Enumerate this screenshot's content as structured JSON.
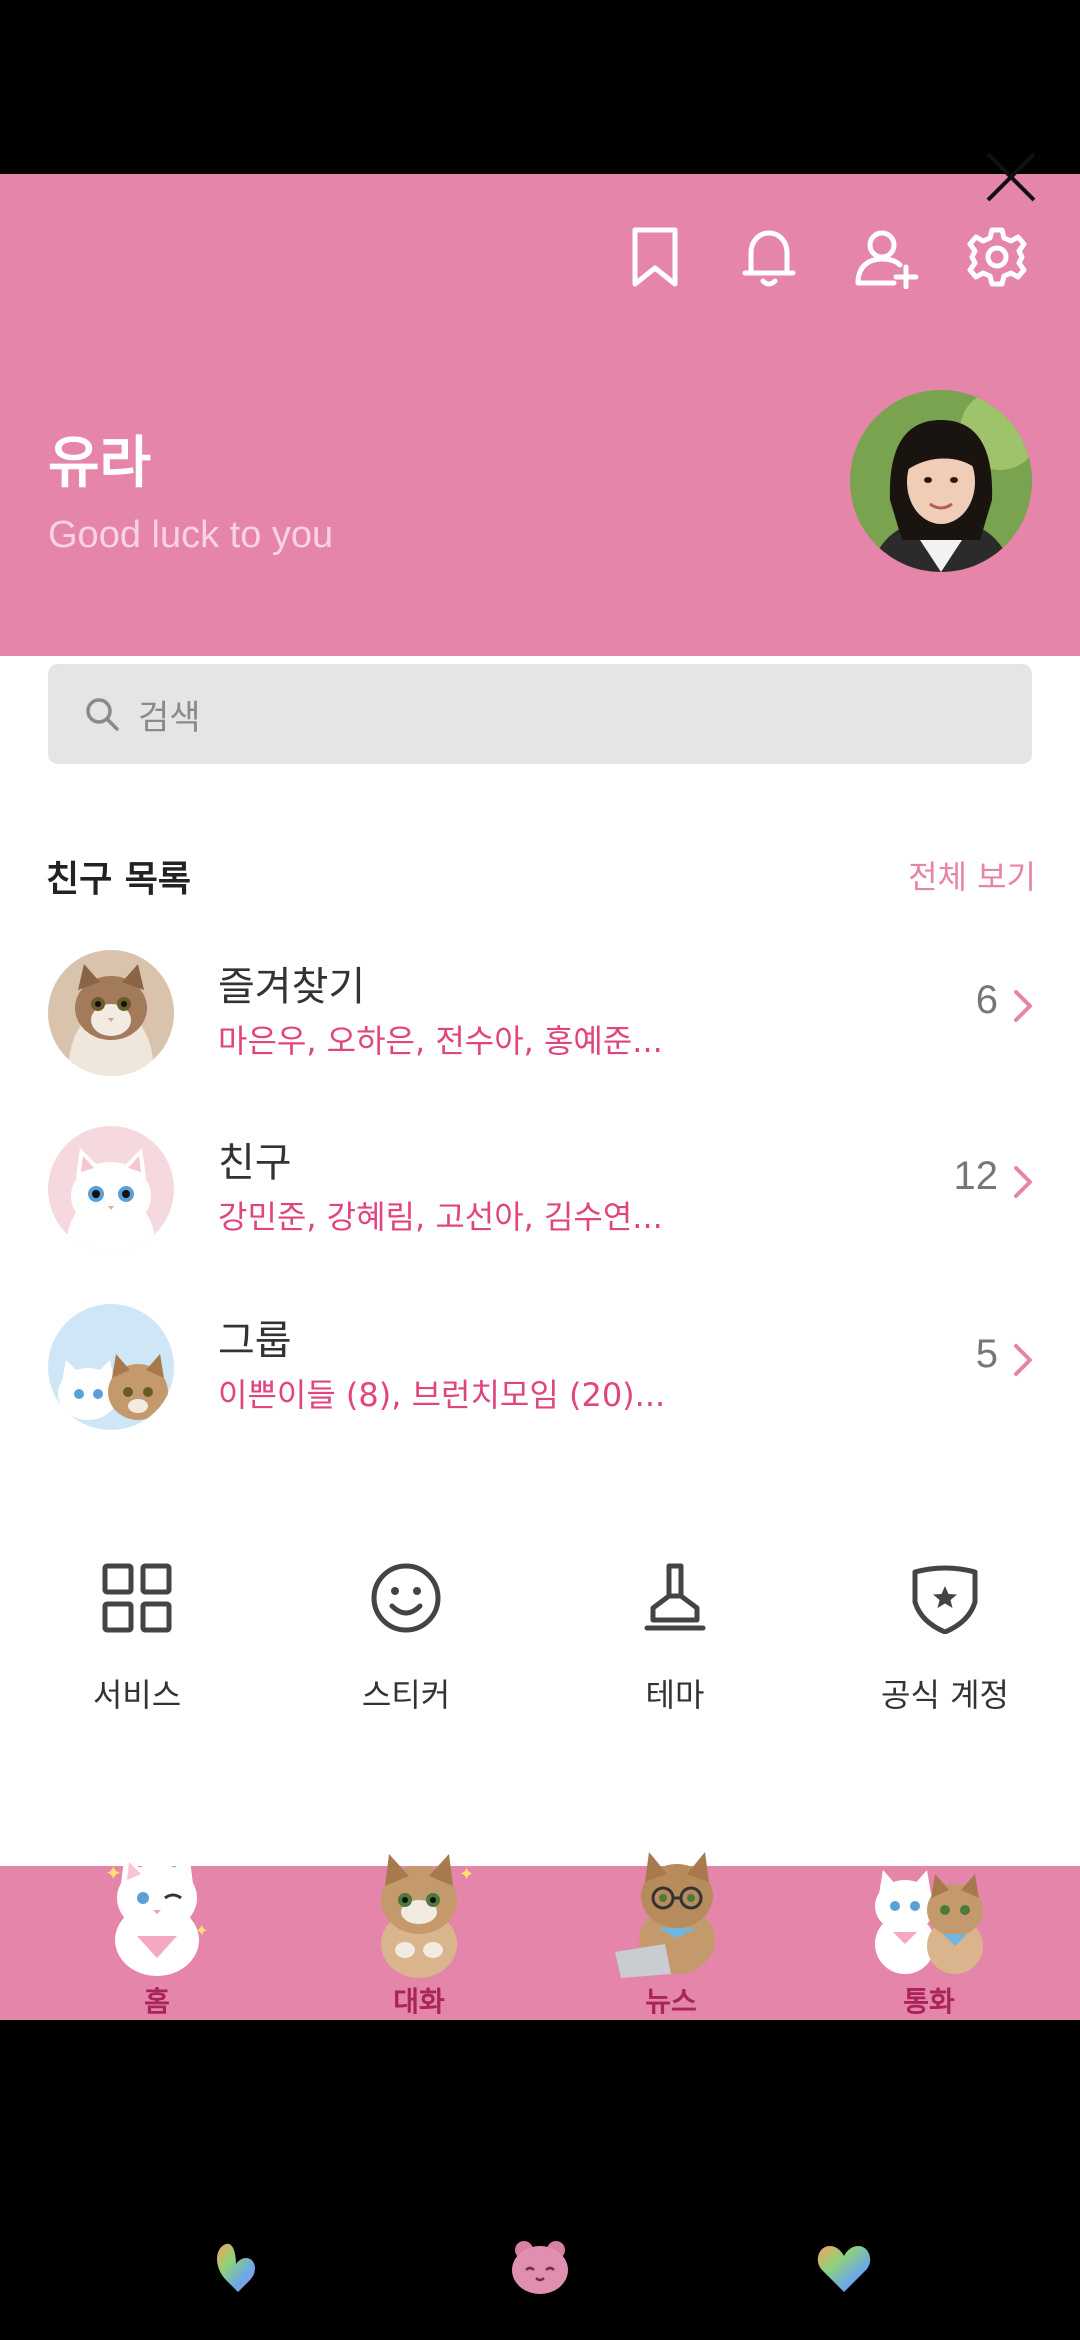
{
  "header": {
    "name": "유라",
    "status": "Good luck to you",
    "icons": [
      "bookmark-icon",
      "bell-icon",
      "add-friend-icon",
      "gear-icon",
      "close-icon"
    ],
    "color": "#e685aa"
  },
  "search": {
    "placeholder": "검색"
  },
  "friends_section": {
    "title": "친구 목록",
    "see_all": "전체 보기",
    "rows": [
      {
        "title": "즐겨찾기",
        "subtitle": "마은우, 오하은, 전수아, 홍예준...",
        "count": "6"
      },
      {
        "title": "친구",
        "subtitle": "강민준, 강혜림, 고선아, 김수연...",
        "count": "12"
      },
      {
        "title": "그룹",
        "subtitle": "이쁜이들 (8), 브런치모임 (20)...",
        "count": "5"
      }
    ]
  },
  "services": [
    {
      "label": "서비스",
      "icon": "grid-icon"
    },
    {
      "label": "스티커",
      "icon": "smiley-icon"
    },
    {
      "label": "테마",
      "icon": "brush-icon"
    },
    {
      "label": "공식 계정",
      "icon": "shield-star-icon"
    }
  ],
  "bottom_nav": [
    {
      "label": "홈"
    },
    {
      "label": "대화"
    },
    {
      "label": "뉴스"
    },
    {
      "label": "통화"
    }
  ],
  "accent_color": "#e0457f"
}
